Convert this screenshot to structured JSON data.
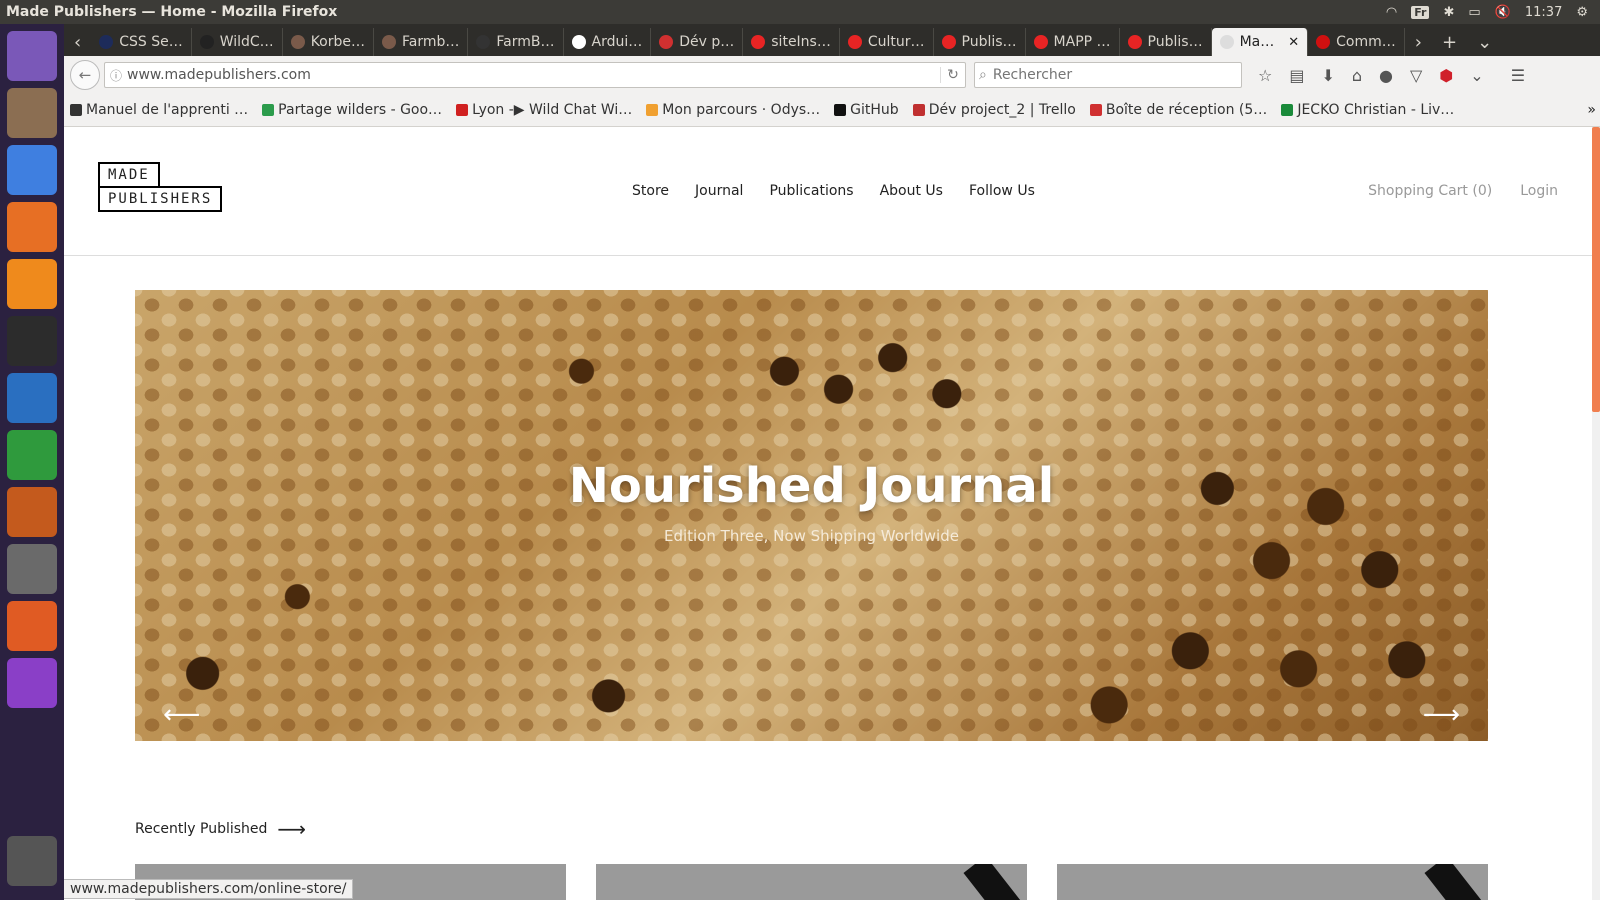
{
  "system": {
    "window_title": "Made Publishers — Home - Mozilla Firefox",
    "keyboard_layout": "Fr",
    "clock": "11:37"
  },
  "launcher": {
    "apps": [
      {
        "name": "ubuntu-dash",
        "color": "#7a58b8"
      },
      {
        "name": "files",
        "color": "#8b6e52"
      },
      {
        "name": "chrome",
        "color": "#3f7fe0"
      },
      {
        "name": "firefox",
        "color": "#e76f24"
      },
      {
        "name": "sublime-text",
        "color": "#ef8a1c"
      },
      {
        "name": "terminal",
        "color": "#2c2c2c"
      },
      {
        "name": "writer",
        "color": "#2a6fc0"
      },
      {
        "name": "calc",
        "color": "#2f9a3d"
      },
      {
        "name": "impress",
        "color": "#c45a1d"
      },
      {
        "name": "system-settings",
        "color": "#6a6a6a"
      },
      {
        "name": "software-center",
        "color": "#e05b23"
      },
      {
        "name": "phpstorm",
        "color": "#8a3fc7"
      }
    ]
  },
  "tabs": [
    {
      "label": "CSS Se…",
      "fav": "#1d2b5a"
    },
    {
      "label": "WildC…",
      "fav": "#222"
    },
    {
      "label": "Korbe…",
      "fav": "#7a5a4a"
    },
    {
      "label": "Farmb…",
      "fav": "#7a5a4a"
    },
    {
      "label": "FarmB…",
      "fav": "#333"
    },
    {
      "label": "Ardui…",
      "fav": "#fff"
    },
    {
      "label": "Dév p…",
      "fav": "#d03030"
    },
    {
      "label": "siteIns…",
      "fav": "#e82424"
    },
    {
      "label": "Cultur…",
      "fav": "#e82424"
    },
    {
      "label": "Publis…",
      "fav": "#e82424"
    },
    {
      "label": "MAPP …",
      "fav": "#e82424"
    },
    {
      "label": "Publis…",
      "fav": "#e82424"
    },
    {
      "label": "Ma…",
      "fav": "#ddd"
    },
    {
      "label": "Comm…",
      "fav": "#d01010"
    }
  ],
  "browser": {
    "url": "www.madepublishers.com",
    "search_placeholder": "Rechercher"
  },
  "bookmarks": [
    {
      "label": "Manuel de l'apprenti …",
      "color": "#333"
    },
    {
      "label": "Partage wilders - Goo…",
      "color": "#2c9c4c"
    },
    {
      "label": "Lyon -▶ Wild Chat Wi…",
      "color": "#d02020"
    },
    {
      "label": "Mon parcours · Odys…",
      "color": "#f0a030"
    },
    {
      "label": "GitHub",
      "color": "#111"
    },
    {
      "label": "Dév project_2 | Trello",
      "color": "#c03030"
    },
    {
      "label": "Boîte de réception (5…",
      "color": "#d03030"
    },
    {
      "label": "JECKO Christian - Liv…",
      "color": "#1a8a3a"
    }
  ],
  "site": {
    "logo_line1": "MADE",
    "logo_line2": "PUBLISHERS",
    "nav": [
      "Store",
      "Journal",
      "Publications",
      "About Us",
      "Follow Us"
    ],
    "cart": "Shopping Cart (0)",
    "login": "Login",
    "hero_title": "Nourished Journal",
    "hero_subtitle": "Edition Three, Now Shipping Worldwide",
    "section_label": "Recently Published"
  },
  "status_bar_url": "www.madepublishers.com/online-store/"
}
